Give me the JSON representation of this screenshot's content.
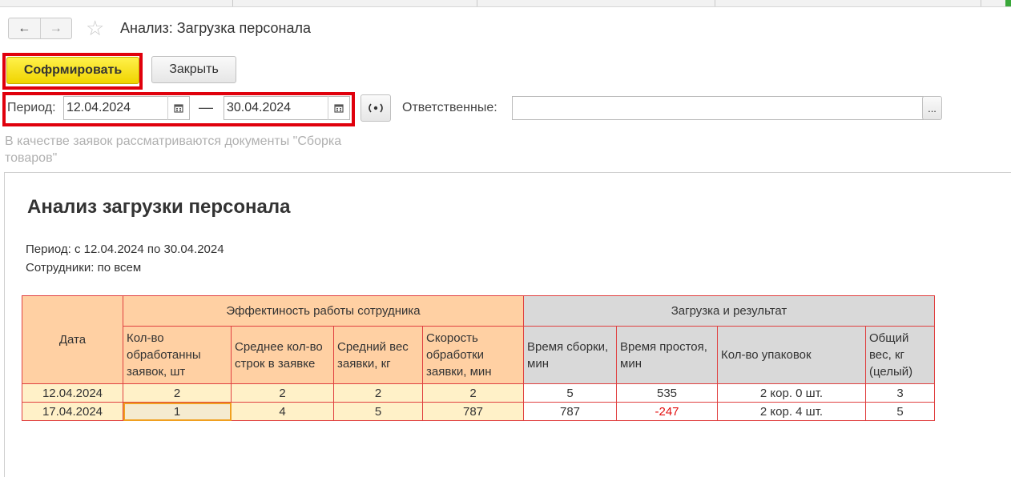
{
  "window": {
    "title": "Анализ: Загрузка персонала"
  },
  "nav": {
    "back_icon": "←",
    "forward_icon": "→",
    "favorite_icon": "☆"
  },
  "toolbar": {
    "generate_label": "Софрмировать",
    "close_label": "Закрыть"
  },
  "filters": {
    "period_label": "Период:",
    "date_from": "12.04.2024",
    "dash": "—",
    "date_to": "30.04.2024",
    "responsible_label": "Ответственные:",
    "responsible_value": "",
    "choose_label": "..."
  },
  "note": "В качестве заявок рассматриваются документы \"Сборка товаров\"",
  "report": {
    "title": "Анализ загрузки персонала",
    "period_line": "Период: с 12.04.2024 по 30.04.2024",
    "employees_line": "Сотрудники: по всем",
    "table": {
      "date_header": "Дата",
      "group1_header": "Эффектиность работы сотрудника",
      "group2_header": "Загрузка и результат",
      "col_headers": [
        "Кол-во обработанны заявок, шт",
        "Среднее кол-во строк в заявке",
        "Средний вес заявки, кг",
        "Скорость обработки заявки, мин",
        "Время сборки, мин",
        "Время простоя, мин",
        "Кол-во упаковок",
        "Общий вес, кг (целый)"
      ],
      "rows": [
        [
          "12.04.2024",
          "2",
          "2",
          "2",
          "2",
          "5",
          "535",
          "2 кор. 0 шт.",
          "3"
        ],
        [
          "17.04.2024",
          "1",
          "4",
          "5",
          "787",
          "787",
          "-247",
          "2 кор. 4 шт.",
          "5"
        ]
      ]
    }
  },
  "colors": {
    "primary_button": "#f5dc00",
    "highlight_frame": "#e0000c",
    "header_orange": "#ffd0a3",
    "header_gray": "#d9d9d9",
    "cell_light": "#fff1c8",
    "negative": "#e31010"
  }
}
